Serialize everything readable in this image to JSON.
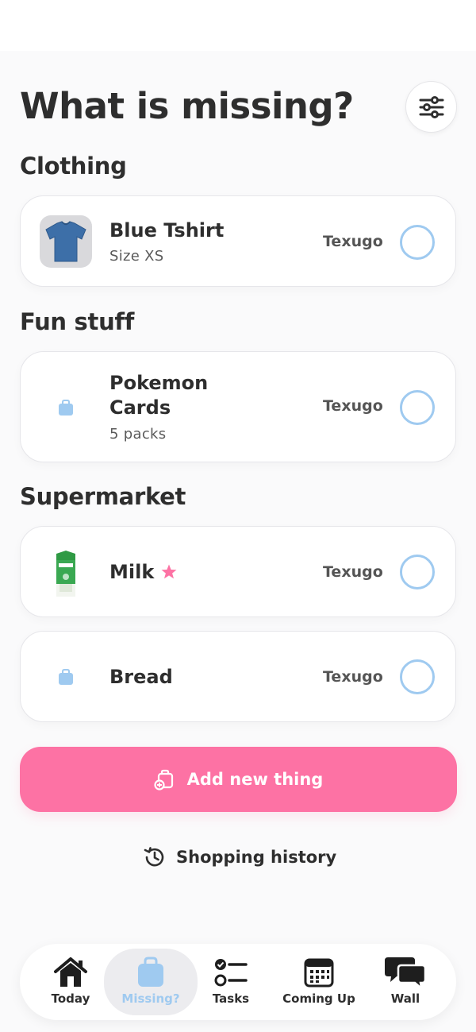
{
  "header": {
    "title": "What is missing?"
  },
  "sections": [
    {
      "title": "Clothing",
      "items": [
        {
          "name": "Blue Tshirt",
          "detail": "Size XS",
          "owner": "Texugo",
          "thumb": "tshirt-photo",
          "favorite": false
        }
      ]
    },
    {
      "title": "Fun stuff",
      "items": [
        {
          "name_line1": "Pokemon",
          "name_line2": "Cards",
          "detail": "5 packs",
          "owner": "Texugo",
          "thumb": "bag-icon",
          "favorite": false
        }
      ]
    },
    {
      "title": "Supermarket",
      "items": [
        {
          "name": "Milk",
          "owner": "Texugo",
          "thumb": "milk-carton-photo",
          "favorite": true
        },
        {
          "name": "Bread",
          "owner": "Texugo",
          "thumb": "bag-icon",
          "favorite": false
        }
      ]
    }
  ],
  "actions": {
    "add_label": "Add new thing",
    "history_label": "Shopping history"
  },
  "tabbar": {
    "tabs": [
      {
        "label": "Today",
        "icon": "house-icon",
        "active": false
      },
      {
        "label": "Missing?",
        "icon": "bag-icon",
        "active": true
      },
      {
        "label": "Tasks",
        "icon": "checklist-icon",
        "active": false
      },
      {
        "label": "Coming Up",
        "icon": "calendar-icon",
        "active": false
      },
      {
        "label": "Wall",
        "icon": "chat-bubbles-icon",
        "active": false
      }
    ]
  },
  "colors": {
    "accent_pink": "#fd72a4",
    "accent_blue": "#9fcaf0",
    "text_dark": "#2e2e2e"
  }
}
